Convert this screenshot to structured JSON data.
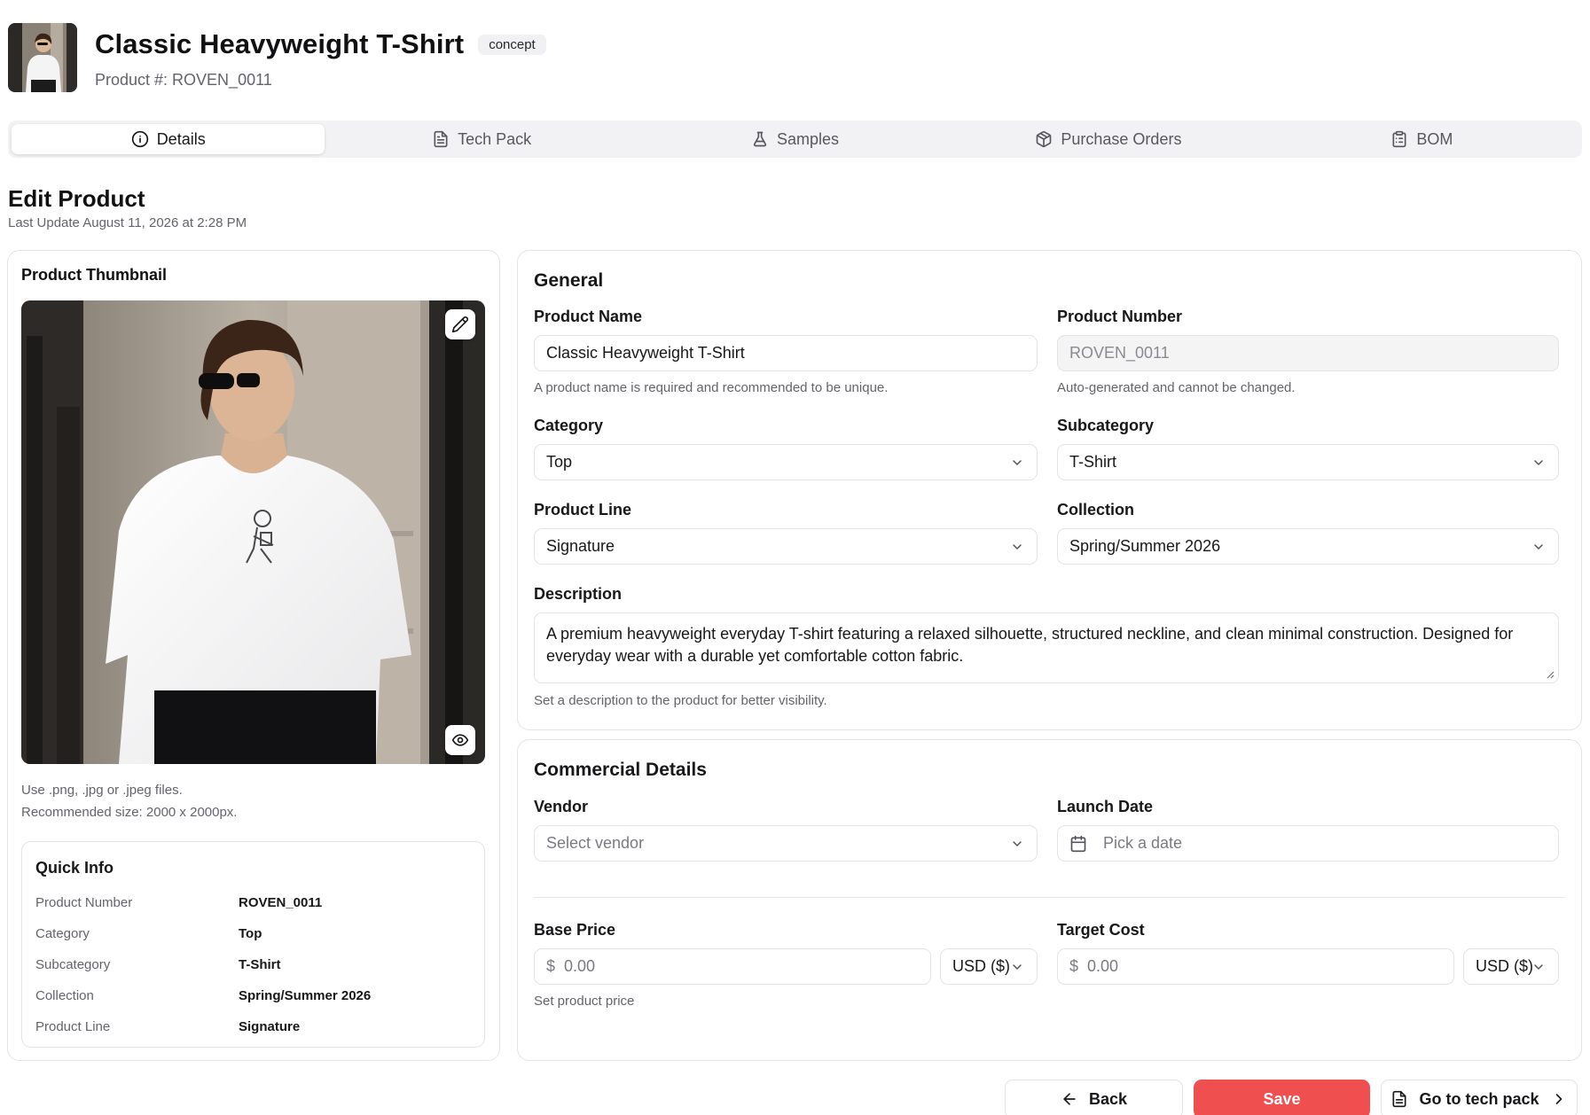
{
  "header": {
    "title": "Classic Heavyweight T-Shirt",
    "status": "concept",
    "product_number_label": "Product #: ROVEN_0011"
  },
  "tabs": [
    {
      "label": "Details",
      "icon": "info-icon",
      "active": true
    },
    {
      "label": "Tech Pack",
      "icon": "file-text-icon",
      "active": false
    },
    {
      "label": "Samples",
      "icon": "flask-icon",
      "active": false
    },
    {
      "label": "Purchase Orders",
      "icon": "package-icon",
      "active": false
    },
    {
      "label": "BOM",
      "icon": "clipboard-list-icon",
      "active": false
    }
  ],
  "section": {
    "title": "Edit Product",
    "last_update": "Last Update August 11, 2026 at 2:28 PM"
  },
  "thumbnail": {
    "title": "Product Thumbnail",
    "hint_line1": "Use .png, .jpg or .jpeg files.",
    "hint_line2": "Recommended size: 2000 x 2000px."
  },
  "quick_info": {
    "title": "Quick Info",
    "rows": [
      {
        "key": "Product Number",
        "value": "ROVEN_0011"
      },
      {
        "key": "Category",
        "value": "Top"
      },
      {
        "key": "Subcategory",
        "value": "T-Shirt"
      },
      {
        "key": "Collection",
        "value": "Spring/Summer 2026"
      },
      {
        "key": "Product Line",
        "value": "Signature"
      }
    ]
  },
  "general": {
    "title": "General",
    "product_name": {
      "label": "Product Name",
      "value": "Classic Heavyweight T-Shirt",
      "help": "A product name is required and recommended to be unique."
    },
    "product_number": {
      "label": "Product Number",
      "value": "ROVEN_0011",
      "help": "Auto-generated and cannot be changed."
    },
    "category": {
      "label": "Category",
      "value": "Top"
    },
    "subcategory": {
      "label": "Subcategory",
      "value": "T-Shirt"
    },
    "product_line": {
      "label": "Product Line",
      "value": "Signature"
    },
    "collection": {
      "label": "Collection",
      "value": "Spring/Summer 2026"
    },
    "description": {
      "label": "Description",
      "value": "A premium heavyweight everyday T-shirt featuring a relaxed silhouette, structured neckline, and clean minimal construction. Designed for everyday wear with a durable yet comfortable cotton fabric.",
      "help": "Set a description to the product for better visibility."
    }
  },
  "commercial": {
    "title": "Commercial Details",
    "vendor": {
      "label": "Vendor",
      "placeholder": "Select vendor"
    },
    "launch_date": {
      "label": "Launch Date",
      "placeholder": "Pick a date"
    },
    "base_price": {
      "label": "Base Price",
      "symbol": "$",
      "value": "0.00",
      "currency": "USD ($)",
      "help": "Set product price"
    },
    "target_cost": {
      "label": "Target Cost",
      "symbol": "$",
      "value": "0.00",
      "currency": "USD ($)"
    }
  },
  "actions": {
    "back": "Back",
    "save": "Save",
    "tech_pack": "Go to tech pack"
  },
  "colors": {
    "primary": "#ef4f4f",
    "border": "#e4e4e7",
    "muted_text": "#63636b"
  }
}
